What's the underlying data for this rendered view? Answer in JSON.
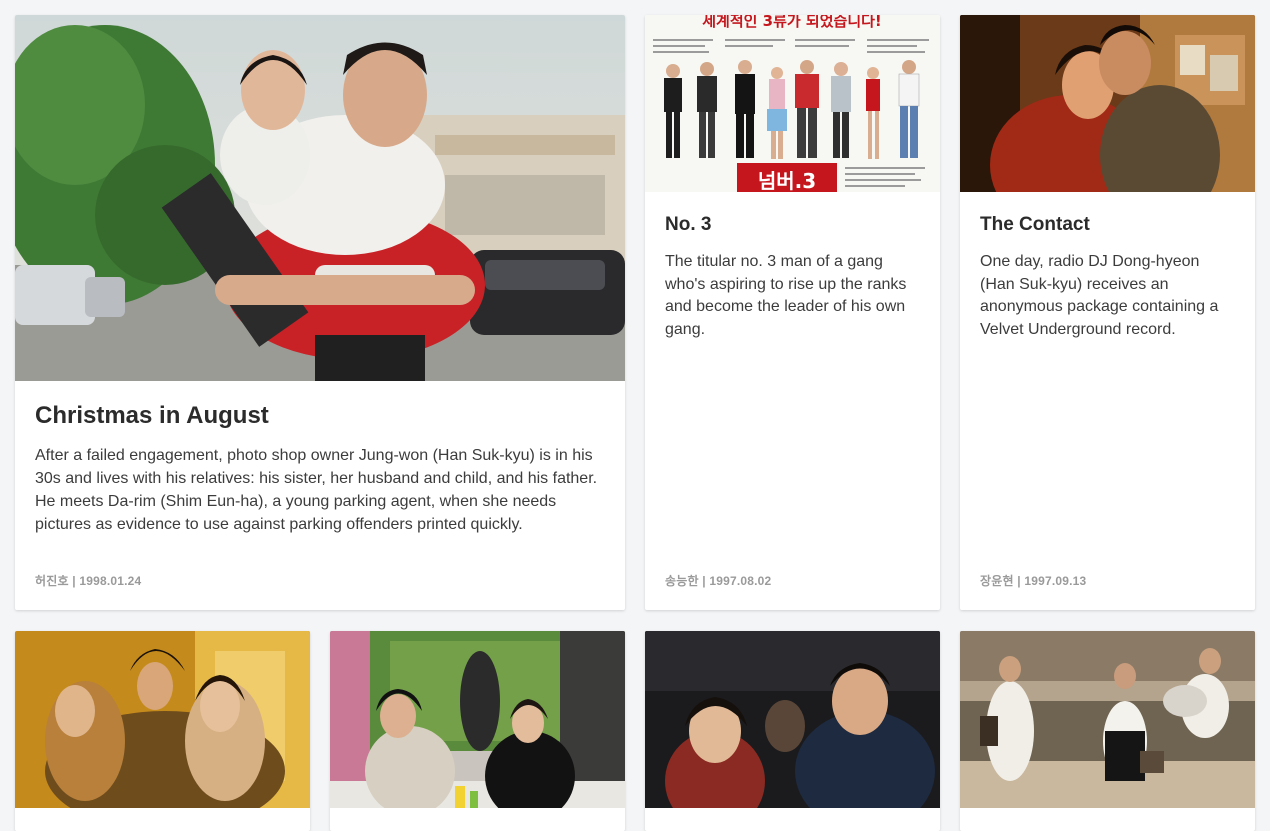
{
  "cards": [
    {
      "title": "Christmas in August",
      "description": "After a failed engagement, photo shop owner Jung-won (Han Suk-kyu) is in his 30s and lives with his relatives: his sister, her husband and child, and his father. He meets Da-rim (Shim Eun-ha), a young parking agent, when she needs pictures as evidence to use against parking offenders printed quickly.",
      "meta": "허진호 | 1998.01.24"
    },
    {
      "title": "No. 3",
      "description": "The titular no. 3 man of a gang who's aspiring to rise up the ranks and become the leader of his own gang.",
      "meta": "송능한 | 1997.08.02",
      "poster_headline": "세계적인 3류가 되었습니다!",
      "poster_logo": "넘버.3"
    },
    {
      "title": "The Contact",
      "description": "One day, radio DJ Dong-hyeon (Han Suk-kyu) receives an anonymous package containing a Velvet Underground record.",
      "meta": "장윤현 | 1997.09.13"
    }
  ],
  "colors": {
    "background": "#f3f5f7",
    "card": "#ffffff",
    "title": "#2b2b2b",
    "meta": "#9a9a9a"
  }
}
